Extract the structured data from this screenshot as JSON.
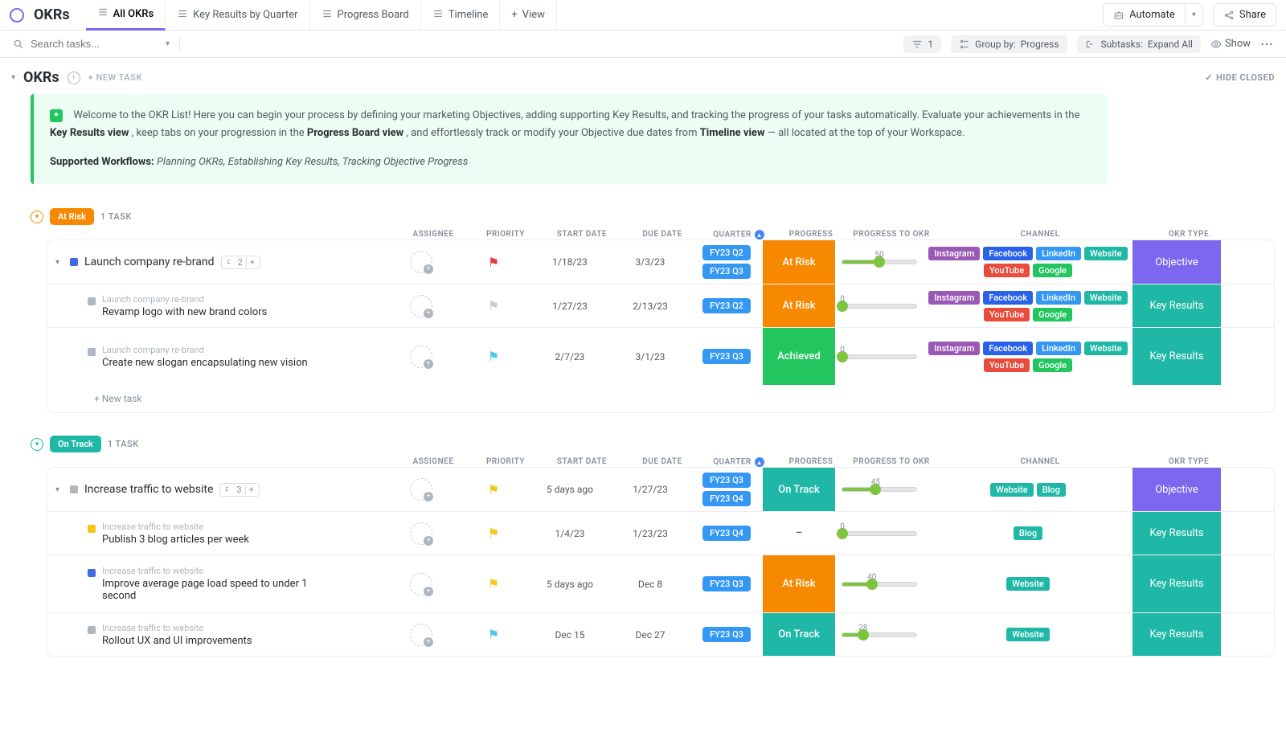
{
  "app": {
    "title": "OKRs"
  },
  "tabs": [
    {
      "label": "All OKRs",
      "active": true
    },
    {
      "label": "Key Results by Quarter"
    },
    {
      "label": "Progress Board"
    },
    {
      "label": "Timeline"
    },
    {
      "label": "View",
      "isAdd": true
    }
  ],
  "topbar": {
    "automate": "Automate",
    "share": "Share"
  },
  "search": {
    "placeholder": "Search tasks..."
  },
  "filters": {
    "filter_count": "1",
    "group_by_label": "Group by:",
    "group_by_value": "Progress",
    "subtasks_label": "Subtasks:",
    "subtasks_value": "Expand All",
    "show": "Show"
  },
  "section": {
    "title": "OKRs",
    "new_task": "+ NEW TASK",
    "hide_closed": "HIDE CLOSED"
  },
  "callout": {
    "intro": "Welcome to the OKR List! Here you can begin your process by defining your marketing Objectives, adding supporting Key Results, and tracking the progress of your tasks automatically. Evaluate your achievements in the ",
    "b1": "Key Results view",
    "mid1": ", keep tabs on your progression in the ",
    "b2": "Progress Board view",
    "mid2": ", and effortlessly track or modify your Objective due dates from ",
    "b3": "Timeline view",
    "tail": " — all located at the top of your Workspace.",
    "workflows_label": "Supported Workflows:",
    "workflows": "Planning OKRs, Establishing Key Results, Tracking Objective Progress"
  },
  "columns": {
    "assignee": "ASSIGNEE",
    "priority": "PRIORITY",
    "start": "START DATE",
    "due": "DUE DATE",
    "quarter": "QUARTER",
    "progress": "PROGRESS",
    "p2okr": "PROGRESS TO OKR",
    "channel": "CHANNEL",
    "okrtype": "OKR TYPE"
  },
  "groups": [
    {
      "status": "At Risk",
      "status_class": "status-atrisk",
      "collapse_color": "#f78900",
      "count": "1 TASK",
      "rows": [
        {
          "type": "parent",
          "sq": "#4169e1",
          "name": "Launch company re-brand",
          "subcount": "2",
          "priority": "red",
          "start": "1/18/23",
          "due": "3/3/23",
          "quarters": [
            "FY23 Q2",
            "FY23 Q3"
          ],
          "progress": "At Risk",
          "pclass": "pc-atrisk",
          "slider": 50,
          "channels": [
            "Instagram",
            "Facebook",
            "LinkedIn",
            "Website",
            "YouTube",
            "Google"
          ],
          "okrtype": "Objective",
          "otclass": "ot-objective"
        },
        {
          "type": "sub",
          "sq": "#b0b6bd",
          "parent": "Launch company re-brand",
          "name": "Revamp logo with new brand colors",
          "priority": "grey",
          "start": "1/27/23",
          "due": "2/13/23",
          "quarters": [
            "FY23 Q2"
          ],
          "progress": "At Risk",
          "pclass": "pc-atrisk",
          "slider": 0,
          "channels": [
            "Instagram",
            "Facebook",
            "LinkedIn",
            "Website",
            "YouTube",
            "Google"
          ],
          "okrtype": "Key Results",
          "otclass": "ot-keyresults"
        },
        {
          "type": "sub",
          "sq": "#b0b6bd",
          "parent": "Launch company re-brand",
          "name": "Create new slogan encapsulating new vision",
          "priority": "cyan",
          "start": "2/7/23",
          "due": "3/1/23",
          "quarters": [
            "FY23 Q3"
          ],
          "progress": "Achieved",
          "pclass": "pc-achieved",
          "slider": 0,
          "channels": [
            "Instagram",
            "Facebook",
            "LinkedIn",
            "Website",
            "YouTube",
            "Google"
          ],
          "okrtype": "Key Results",
          "otclass": "ot-keyresults",
          "tall": true
        }
      ],
      "add": "+ New task"
    },
    {
      "status": "On Track",
      "status_class": "status-ontrack",
      "collapse_color": "#1fb8a6",
      "count": "1 TASK",
      "rows": [
        {
          "type": "parent",
          "sq": "#b0b6bd",
          "name": "Increase traffic to website",
          "subcount": "3",
          "priority": "yellow",
          "start": "5 days ago",
          "due": "1/27/23",
          "quarters": [
            "FY23 Q3",
            "FY23 Q4"
          ],
          "progress": "On Track",
          "pclass": "pc-ontrack",
          "slider": 45,
          "channels": [
            "Website",
            "Blog"
          ],
          "okrtype": "Objective",
          "otclass": "ot-objective"
        },
        {
          "type": "sub",
          "sq": "#f5c518",
          "parent": "Increase traffic to website",
          "name": "Publish 3 blog articles per week",
          "priority": "yellow",
          "start": "1/4/23",
          "due": "1/23/23",
          "quarters": [
            "FY23 Q4"
          ],
          "progress": "–",
          "pclass": "pc-dash",
          "slider": 0,
          "channels": [
            "Blog"
          ],
          "okrtype": "Key Results",
          "otclass": "ot-keyresults"
        },
        {
          "type": "sub",
          "sq": "#4169e1",
          "parent": "Increase traffic to website",
          "name": "Improve average page load speed to under 1 second",
          "priority": "yellow",
          "start": "5 days ago",
          "due": "Dec 8",
          "quarters": [
            "FY23 Q3"
          ],
          "progress": "At Risk",
          "pclass": "pc-atrisk",
          "slider": 40,
          "channels": [
            "Website"
          ],
          "okrtype": "Key Results",
          "otclass": "ot-keyresults",
          "tall": true
        },
        {
          "type": "sub",
          "sq": "#b0b6bd",
          "parent": "Increase traffic to website",
          "name": "Rollout UX and UI improvements",
          "priority": "cyan",
          "start": "Dec 15",
          "due": "Dec 27",
          "quarters": [
            "FY23 Q3"
          ],
          "progress": "On Track",
          "pclass": "pc-ontrack",
          "slider": 28,
          "channels": [
            "Website"
          ],
          "okrtype": "Key Results",
          "otclass": "ot-keyresults"
        }
      ]
    }
  ],
  "channel_class": {
    "Instagram": "t-instagram",
    "Facebook": "t-facebook",
    "LinkedIn": "t-linkedin",
    "Website": "t-website",
    "YouTube": "t-youtube",
    "Google": "t-google",
    "Blog": "t-blog"
  }
}
